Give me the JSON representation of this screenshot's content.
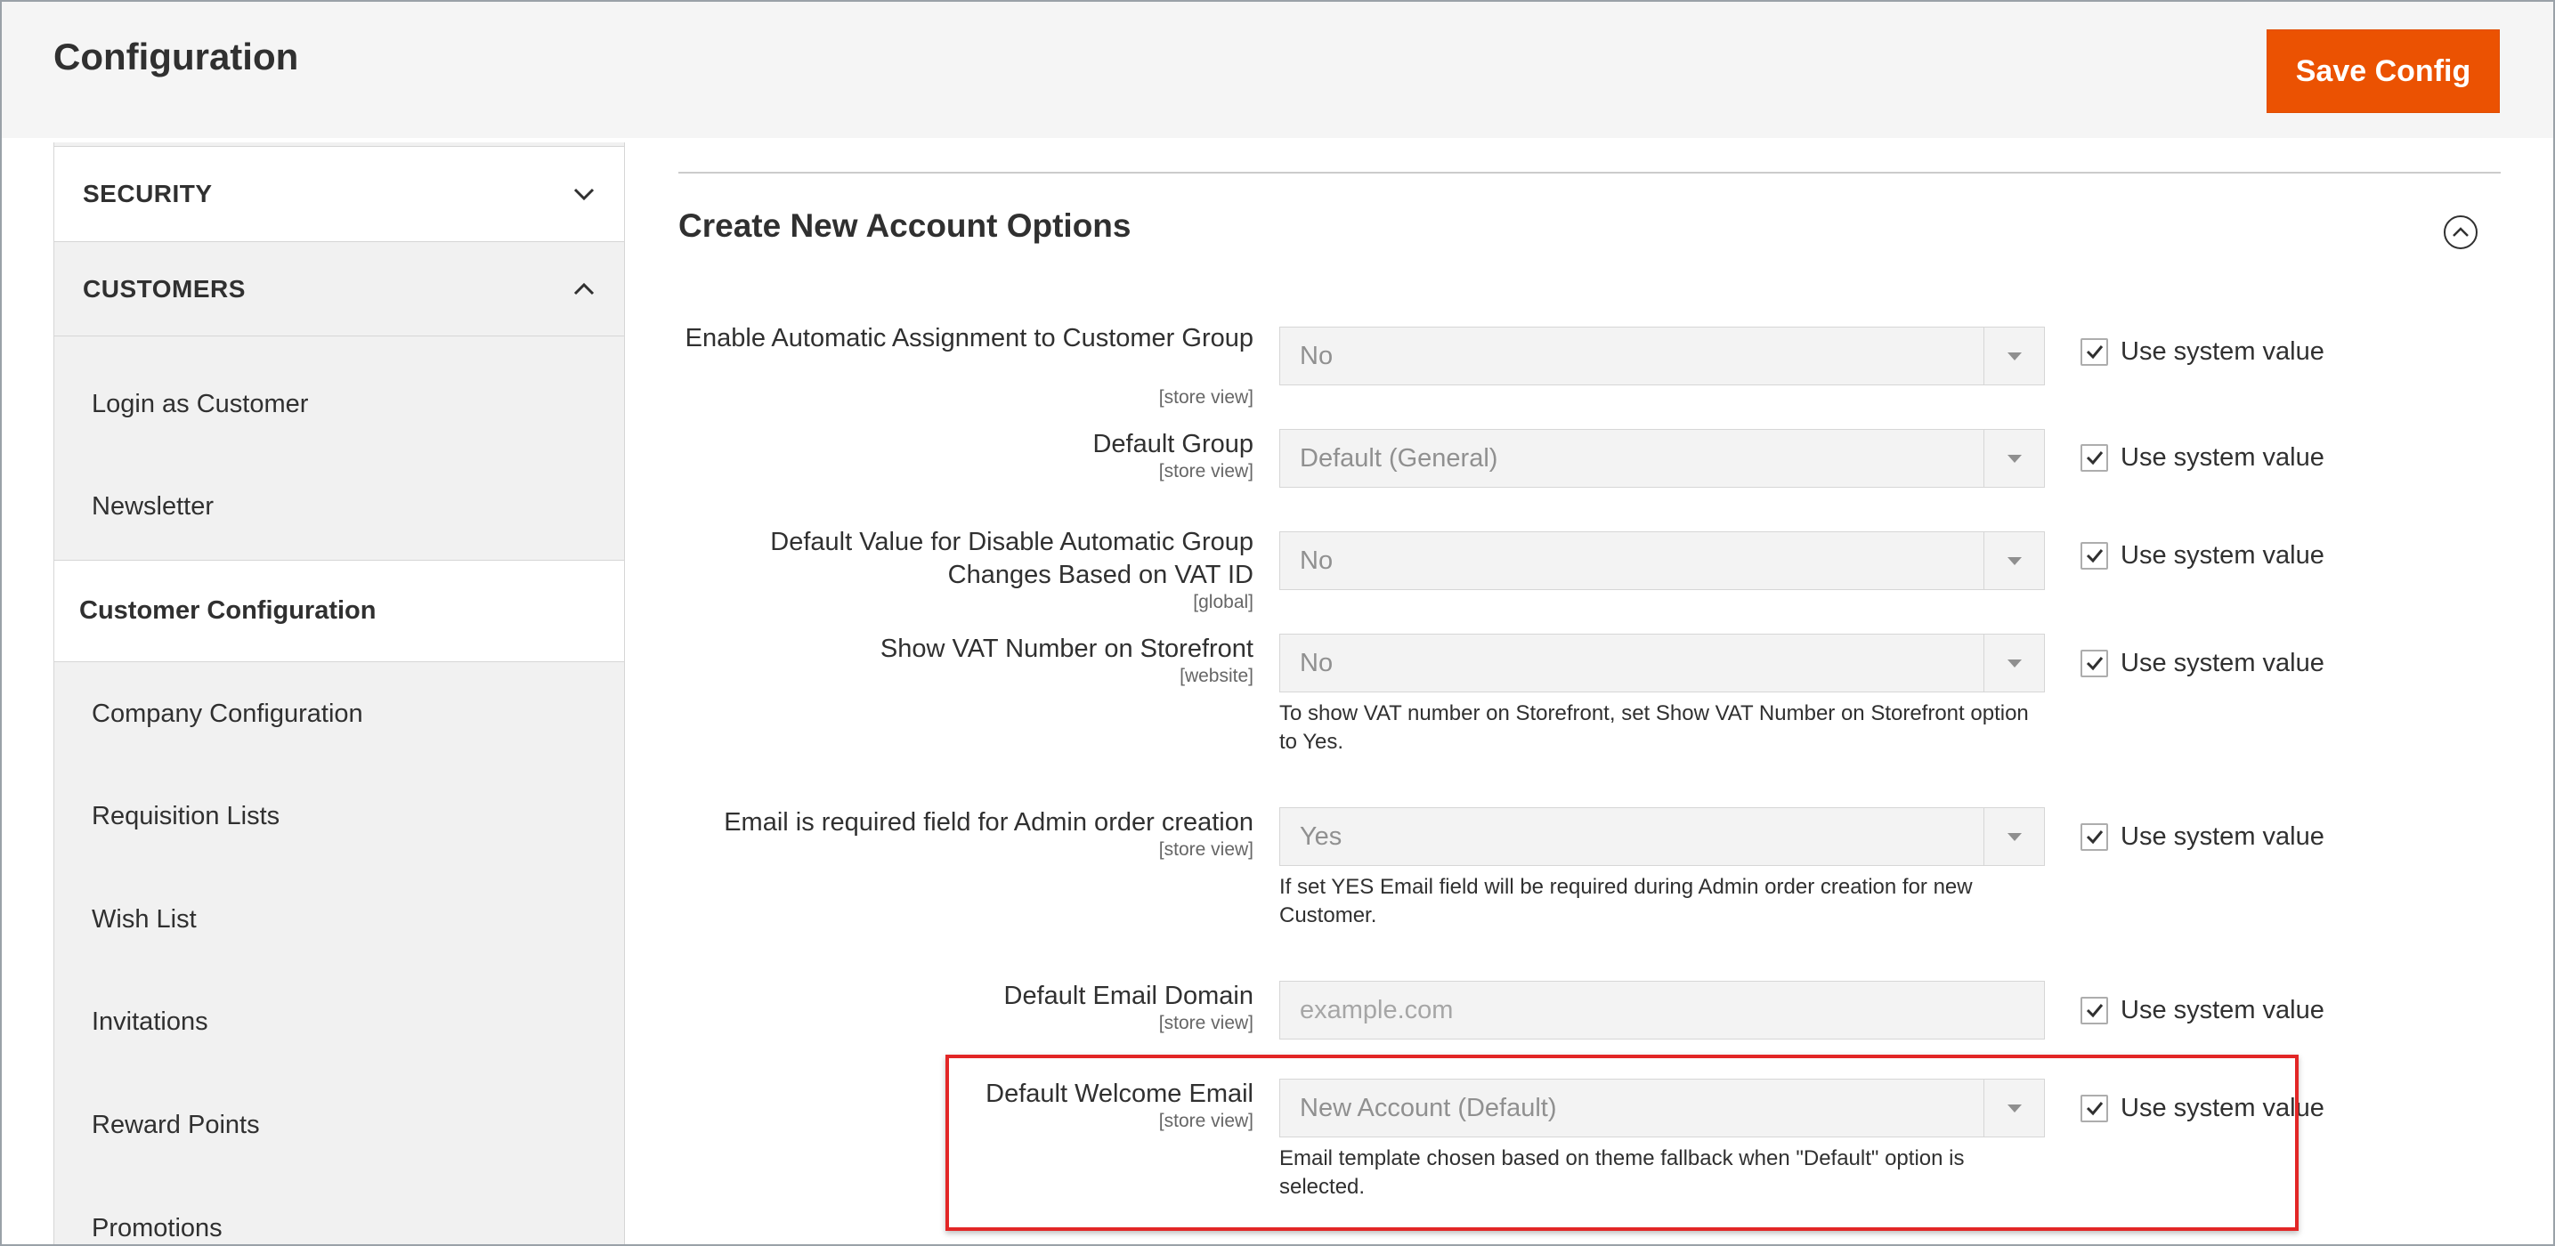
{
  "header": {
    "title": "Configuration",
    "save_label": "Save Config"
  },
  "sidebar": {
    "sections": [
      {
        "label": "SECURITY",
        "state": "collapsed"
      },
      {
        "label": "CUSTOMERS",
        "state": "expanded"
      }
    ],
    "items": [
      {
        "label": "Login as Customer"
      },
      {
        "label": "Newsletter"
      },
      {
        "label": "Customer Configuration",
        "active": true
      },
      {
        "label": "Company Configuration"
      },
      {
        "label": "Requisition Lists"
      },
      {
        "label": "Wish List"
      },
      {
        "label": "Invitations"
      },
      {
        "label": "Reward Points"
      },
      {
        "label": "Promotions"
      }
    ]
  },
  "main": {
    "section_title": "Create New Account Options",
    "system_value_label": "Use system value",
    "fields": [
      {
        "label": "Enable Automatic Assignment to Customer Group",
        "scope": "[store view]",
        "type": "select",
        "value": "No",
        "use_system_value": true
      },
      {
        "label": "Default Group",
        "scope": "[store view]",
        "type": "select",
        "value": "Default (General)",
        "use_system_value": true
      },
      {
        "label": "Default Value for Disable Automatic Group Changes Based on VAT ID",
        "scope": "[global]",
        "type": "select",
        "value": "No",
        "use_system_value": true
      },
      {
        "label": "Show VAT Number on Storefront",
        "scope": "[website]",
        "type": "select",
        "value": "No",
        "use_system_value": true,
        "note": "To show VAT number on Storefront, set Show VAT Number on Storefront option to Yes."
      },
      {
        "label": "Email is required field for Admin order creation",
        "scope": "[store view]",
        "type": "select",
        "value": "Yes",
        "use_system_value": true,
        "note": "If set YES Email field will be required during Admin order creation for new Customer."
      },
      {
        "label": "Default Email Domain",
        "scope": "[store view]",
        "type": "text",
        "placeholder": "example.com",
        "use_system_value": true
      },
      {
        "label": "Default Welcome Email",
        "scope": "[store view]",
        "type": "select",
        "value": "New Account (Default)",
        "use_system_value": true,
        "note": "Email template chosen based on theme fallback when \"Default\" option is selected.",
        "highlighted": true
      }
    ]
  },
  "colors": {
    "accent": "#eb5202",
    "highlight_border": "#e22626"
  }
}
